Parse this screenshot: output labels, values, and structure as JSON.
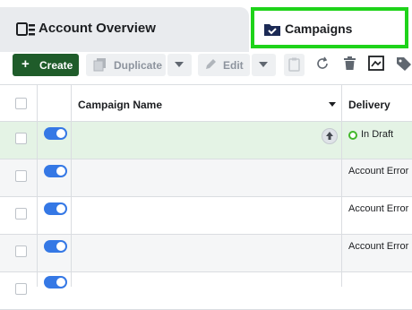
{
  "tabs": {
    "account_overview": "Account Overview",
    "campaigns": "Campaigns"
  },
  "toolbar": {
    "create": "Create",
    "duplicate": "Duplicate",
    "edit": "Edit"
  },
  "table": {
    "headers": {
      "campaign_name": "Campaign Name",
      "delivery": "Delivery"
    },
    "rows": [
      {
        "status": "In Draft",
        "toggle": "on"
      },
      {
        "status": "Account Error",
        "toggle": "on"
      },
      {
        "status": "Account Error",
        "toggle": "on"
      },
      {
        "status": "Account Error",
        "toggle": "on"
      },
      {
        "status": "",
        "toggle": "on"
      }
    ]
  },
  "colors": {
    "highlight_border": "#1ed31a",
    "create_button": "#1f5c2a",
    "toggle_on": "#3578e5",
    "draft_row": "#e4f3e5"
  }
}
